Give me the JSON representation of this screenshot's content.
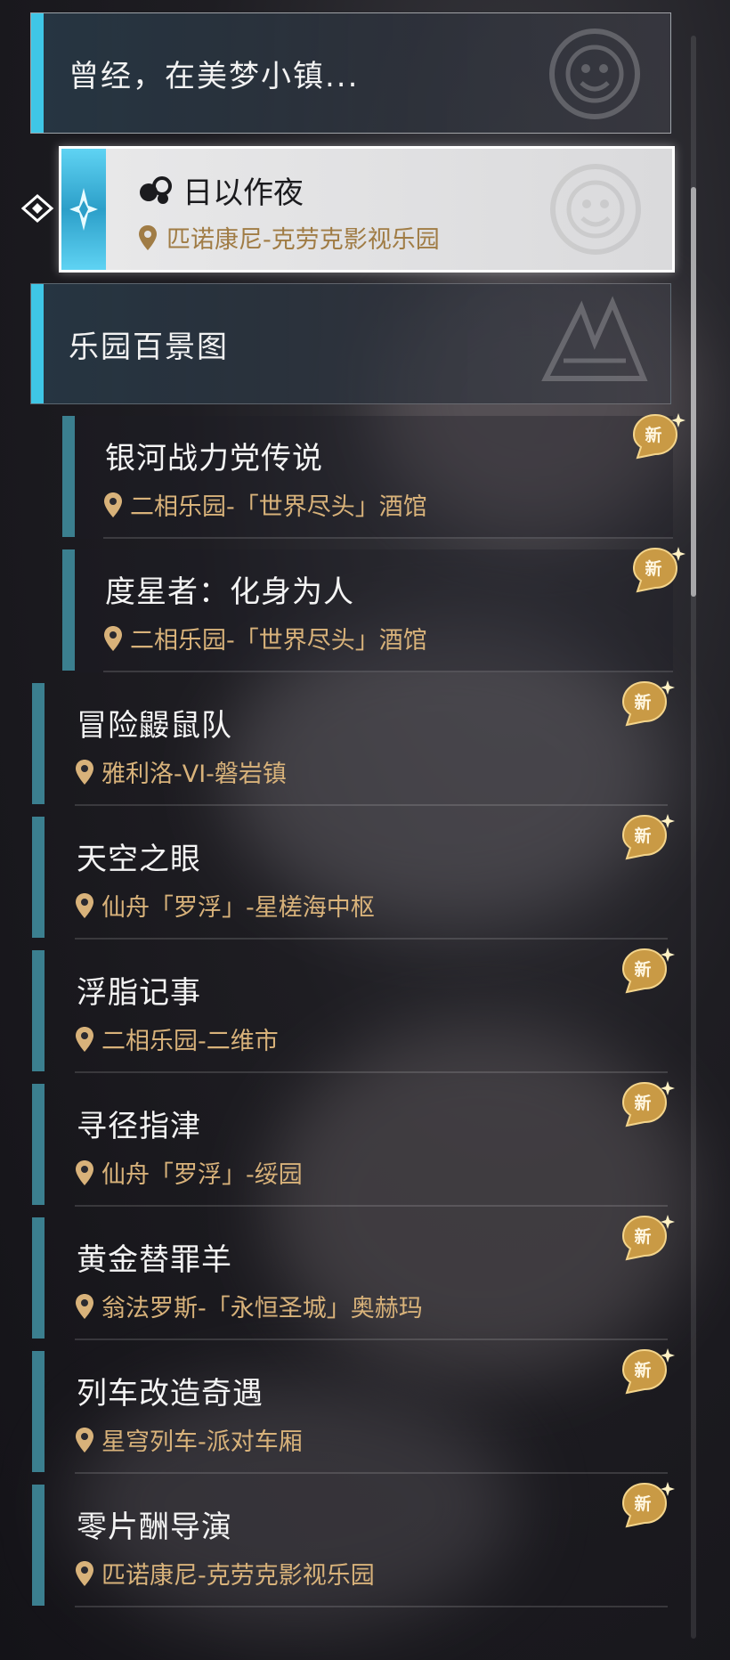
{
  "groups": [
    {
      "title": "曾经，在美梦小镇..."
    },
    {
      "title": "乐园百景图"
    }
  ],
  "selected_quest": {
    "title": "日以作夜",
    "location": "匹诺康尼-克劳克影视乐园"
  },
  "sub_quests": [
    {
      "title": "银河战力党传说",
      "location": "二相乐园-「世界尽头」酒馆",
      "badge": "新"
    },
    {
      "title": "度星者：化身为人",
      "location": "二相乐园-「世界尽头」酒馆",
      "badge": "新"
    }
  ],
  "quests": [
    {
      "title": "冒险鼹鼠队",
      "location": "雅利洛-VI-磐岩镇",
      "badge": "新"
    },
    {
      "title": "天空之眼",
      "location": "仙舟「罗浮」-星槎海中枢",
      "badge": "新"
    },
    {
      "title": "浮脂记事",
      "location": "二相乐园-二维市",
      "badge": "新"
    },
    {
      "title": "寻径指津",
      "location": "仙舟「罗浮」-绥园",
      "badge": "新"
    },
    {
      "title": "黄金替罪羊",
      "location": "翁法罗斯-「永恒圣城」奥赫玛",
      "badge": "新"
    },
    {
      "title": "列车改造奇遇",
      "location": "星穹列车-派对车厢",
      "badge": "新"
    },
    {
      "title": "零片酬导演",
      "location": "匹诺康尼-克劳克影视乐园",
      "badge": "新"
    }
  ],
  "colors": {
    "accent": "#3fc6e6",
    "location_text": "#d8b27a",
    "badge": "#c99a45"
  }
}
